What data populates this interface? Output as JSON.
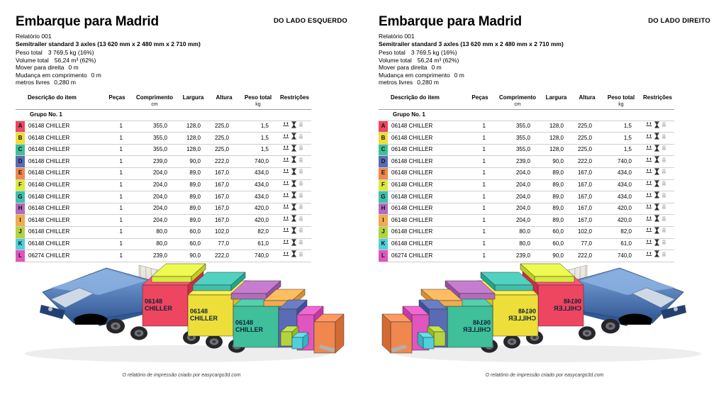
{
  "panels": [
    {
      "title": "Embarque para Madrid",
      "side_label": "DO LADO ESQUERDO",
      "report": "Relatório 001",
      "vehicle": "Semitrailer standard 3 axles (13 620 mm x 2 480 mm x 2 710 mm)",
      "stats": [
        {
          "label": "Peso total",
          "value": "3 769,5 kg (16%)"
        },
        {
          "label": "Volume total",
          "value": "56,24 m³ (62%)"
        },
        {
          "label": "Mover para direita",
          "value": "0 m"
        },
        {
          "label": "Mudança em comprimento",
          "value": "0 m"
        },
        {
          "label": "metros livres",
          "value": "0,280 m"
        }
      ],
      "footer": "O relatório de impressão criado por easycargo3d.com",
      "mirrored": false
    },
    {
      "title": "Embarque para Madrid",
      "side_label": "DO LADO DIREITO",
      "report": "Relatório 001",
      "vehicle": "Semitrailer standard 3 axles (13 620 mm x 2 480 mm x 2 710 mm)",
      "stats": [
        {
          "label": "Peso total",
          "value": "3 769,5 kg (16%)"
        },
        {
          "label": "Volume total",
          "value": "56,24 m³ (62%)"
        },
        {
          "label": "Mover para direita",
          "value": "0 m"
        },
        {
          "label": "Mudança em comprimento",
          "value": "0 m"
        },
        {
          "label": "metros livres",
          "value": "0,280 m"
        }
      ],
      "footer": "O relatório de impressão criado por easycargo3d.com",
      "mirrored": true
    }
  ],
  "table": {
    "columns": [
      {
        "label": "",
        "unit": ""
      },
      {
        "label": "Descrição do item",
        "unit": ""
      },
      {
        "label": "Peças",
        "unit": ""
      },
      {
        "label": "Comprimento",
        "unit": "cm"
      },
      {
        "label": "Largura",
        "unit": ""
      },
      {
        "label": "Altura",
        "unit": ""
      },
      {
        "label": "Peso total",
        "unit": "kg"
      },
      {
        "label": "Restrições",
        "unit": ""
      }
    ],
    "group_label": "Grupo No. 1",
    "rows": [
      {
        "letter": "A",
        "color": "#ee4560",
        "desc": "06148 CHILLER",
        "pieces": "1",
        "length": "355,0",
        "width": "128,0",
        "height": "225,0",
        "weight": "1,5",
        "restrictions": [
          "stack-icon",
          "fragile-hourglass-icon",
          "no-tilt-icon-disabled"
        ]
      },
      {
        "letter": "B",
        "color": "#eede3a",
        "desc": "06148 CHILLER",
        "pieces": "1",
        "length": "355,0",
        "width": "128,0",
        "height": "225,0",
        "weight": "1,5",
        "restrictions": [
          "stack-icon",
          "fragile-hourglass-icon",
          "no-tilt-icon-disabled"
        ]
      },
      {
        "letter": "C",
        "color": "#3fbf9a",
        "desc": "06148 CHILLER",
        "pieces": "1",
        "length": "355,0",
        "width": "128,0",
        "height": "225,0",
        "weight": "1,5",
        "restrictions": [
          "stack-icon",
          "fragile-hourglass-icon",
          "no-tilt-icon-disabled"
        ]
      },
      {
        "letter": "D",
        "color": "#5a6bb5",
        "desc": "06148 CHILLER",
        "pieces": "1",
        "length": "239,0",
        "width": "90,0",
        "height": "222,0",
        "weight": "740,0",
        "restrictions": [
          "stack-icon",
          "fragile-hourglass-icon",
          "no-tilt-icon-disabled"
        ]
      },
      {
        "letter": "E",
        "color": "#f0874f",
        "desc": "06148 CHILLER",
        "pieces": "1",
        "length": "204,0",
        "width": "89,0",
        "height": "167,0",
        "weight": "434,0",
        "restrictions": [
          "stack-icon",
          "fragile-hourglass-icon",
          "no-tilt-icon-disabled"
        ]
      },
      {
        "letter": "F",
        "color": "#dbe83f",
        "desc": "06148 CHILLER",
        "pieces": "1",
        "length": "204,0",
        "width": "89,0",
        "height": "167,0",
        "weight": "434,0",
        "restrictions": [
          "stack-icon",
          "fragile-hourglass-icon",
          "no-tilt-icon-disabled"
        ]
      },
      {
        "letter": "G",
        "color": "#3fbfae",
        "desc": "06148 CHILLER",
        "pieces": "1",
        "length": "204,0",
        "width": "89,0",
        "height": "167,0",
        "weight": "434,0",
        "restrictions": [
          "stack-icon",
          "fragile-hourglass-icon",
          "no-tilt-icon-disabled"
        ]
      },
      {
        "letter": "H",
        "color": "#b46bbd",
        "desc": "06148 CHILLER",
        "pieces": "1",
        "length": "204,0",
        "width": "89,0",
        "height": "167,0",
        "weight": "420,0",
        "restrictions": [
          "stack-icon",
          "fragile-hourglass-icon",
          "no-tilt-icon-disabled"
        ]
      },
      {
        "letter": "I",
        "color": "#f0ab4f",
        "desc": "06148 CHILLER",
        "pieces": "1",
        "length": "204,0",
        "width": "89,0",
        "height": "167,0",
        "weight": "420,0",
        "restrictions": [
          "stack-icon",
          "fragile-hourglass-icon",
          "no-tilt-icon-disabled"
        ]
      },
      {
        "letter": "J",
        "color": "#b3d43f",
        "desc": "06148 CHILLER",
        "pieces": "1",
        "length": "80,0",
        "width": "60,0",
        "height": "102,0",
        "weight": "82,0",
        "restrictions": [
          "stack-icon",
          "fragile-hourglass-icon",
          "no-tilt-icon-disabled"
        ]
      },
      {
        "letter": "K",
        "color": "#4fd0dc",
        "desc": "06148 CHILLER",
        "pieces": "1",
        "length": "80,0",
        "width": "60,0",
        "height": "77,0",
        "weight": "61,0",
        "restrictions": [
          "stack-icon",
          "fragile-hourglass-icon",
          "no-tilt-icon-disabled"
        ]
      },
      {
        "letter": "L",
        "color": "#e055c0",
        "desc": "06274 CHILLER",
        "pieces": "1",
        "length": "239,0",
        "width": "90,0",
        "height": "222,0",
        "weight": "740,0",
        "restrictions": [
          "stack-icon",
          "fragile-hourglass-icon",
          "no-tilt-icon-disabled"
        ]
      }
    ]
  },
  "illustration": {
    "cargo_label_main": "06148",
    "cargo_label_sub": "CHILLER",
    "cargo_label_alt": "06274 CHILLER",
    "cab_color": "#4a74b8",
    "trailer_color": "#d8d5cf"
  }
}
